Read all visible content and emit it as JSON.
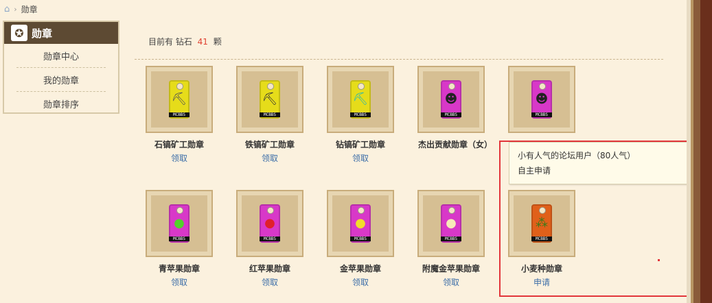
{
  "breadcrumb": {
    "home_icon": "home-icon",
    "current": "勋章"
  },
  "sidebar": {
    "title": "勋章",
    "items": [
      {
        "label": "勋章中心"
      },
      {
        "label": "我的勋章"
      },
      {
        "label": "勋章排序"
      }
    ]
  },
  "summary": {
    "prefix": "目前有 钻石",
    "count": "41",
    "suffix": "颗"
  },
  "medals": [
    {
      "name": "石镐矿工勋章",
      "action": "领取",
      "color": "#e6dc1a",
      "art": "⛏"
    },
    {
      "name": "铁镐矿工勋章",
      "action": "领取",
      "color": "#e6dc1a",
      "art": "⛏"
    },
    {
      "name": "钻镐矿工勋章",
      "action": "领取",
      "color": "#e6dc1a",
      "art": "⛏"
    },
    {
      "name": "杰出贡献勋章（女）",
      "action": "",
      "color": "#d838c8",
      "art": "☺"
    },
    {
      "name": "",
      "action": "",
      "color": "#d838c8",
      "art": "☺"
    },
    {
      "name": "青苹果勋章",
      "action": "领取",
      "color": "#d838c8",
      "art": "●"
    },
    {
      "name": "红苹果勋章",
      "action": "领取",
      "color": "#d838c8",
      "art": "●"
    },
    {
      "name": "金苹果勋章",
      "action": "领取",
      "color": "#d838c8",
      "art": "●"
    },
    {
      "name": "附魔金苹果勋章",
      "action": "领取",
      "color": "#d838c8",
      "art": "●"
    },
    {
      "name": "小麦种勋章",
      "action": "申请",
      "color": "#e0601a",
      "art": "⁂"
    }
  ],
  "tooltip": {
    "line1": "小有人气的论坛用户（80人气）",
    "line2": "自主申请"
  },
  "colors": {
    "accent_red": "#e2353a",
    "link": "#3d6ea8",
    "header": "#5d4a33"
  }
}
